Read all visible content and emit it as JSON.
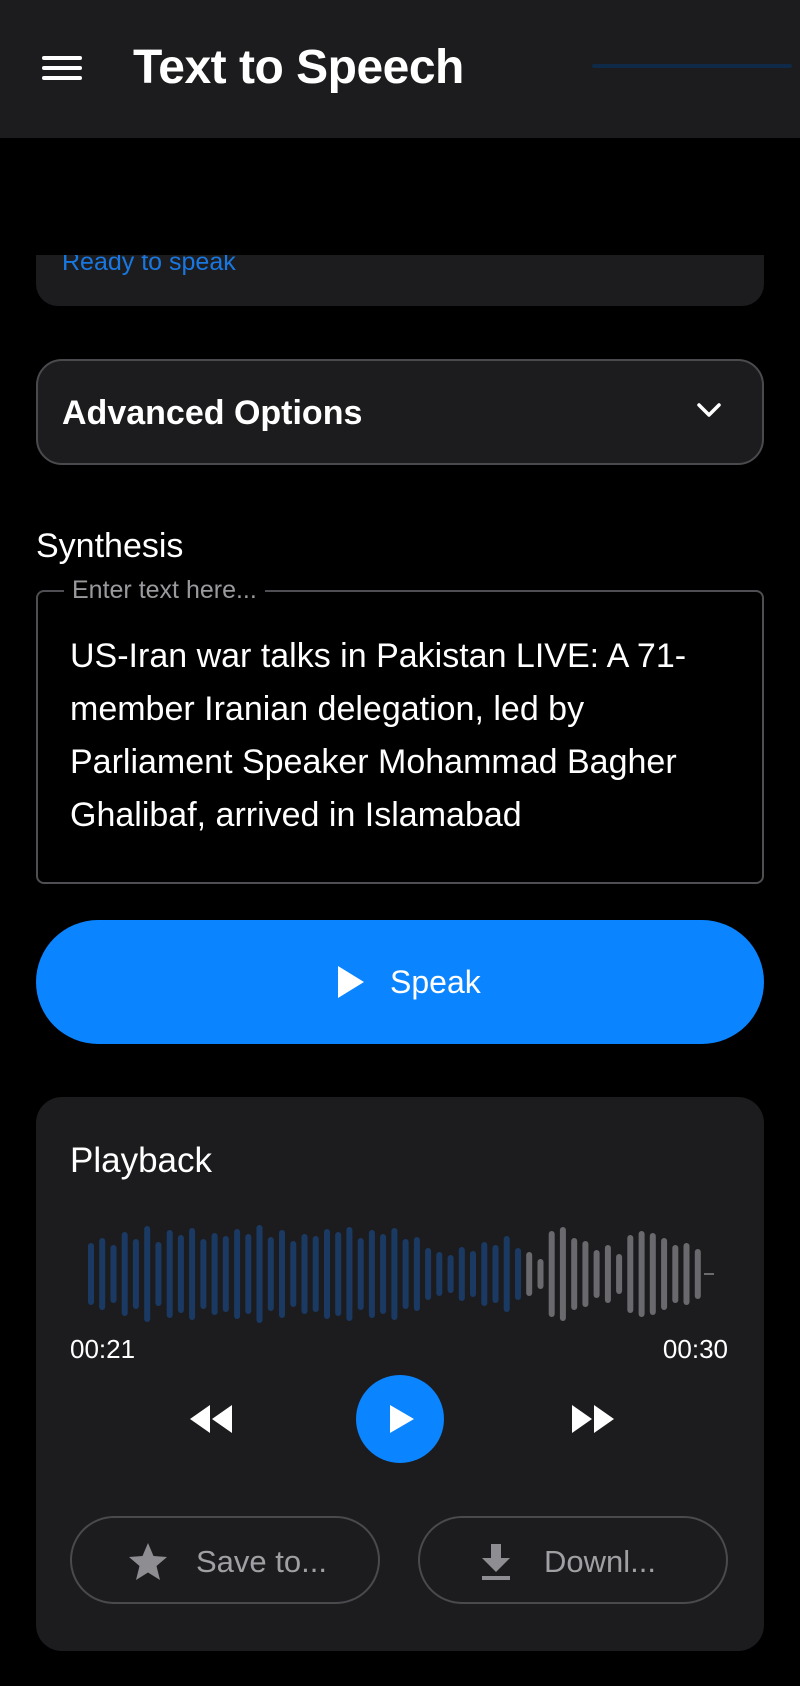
{
  "appbar": {
    "title": "Text to Speech",
    "menu_icon": "hamburger-menu-icon"
  },
  "status": {
    "text": "Ready to speak"
  },
  "advanced_options": {
    "label": "Advanced Options",
    "icon": "chevron-down-icon",
    "expanded": false
  },
  "synthesis": {
    "section_title": "Synthesis",
    "placeholder": "Enter text here...",
    "text": "US-Iran war talks in Pakistan LIVE: A 71-member Iranian delegation, led by Parliament Speaker Mohammad Bagher Ghalibaf, arrived in Islamabad"
  },
  "speak_button": {
    "label": "Speak",
    "icon": "play-icon"
  },
  "playback": {
    "title": "Playback",
    "current_time": "00:21",
    "total_time": "00:30",
    "progress": 0.7,
    "rewind_icon": "rewind-icon",
    "play_icon": "play-icon",
    "forward_icon": "fast-forward-icon",
    "save_label": "Save to...",
    "save_icon": "star-icon",
    "download_label": "Downl...",
    "download_icon": "download-icon"
  },
  "colors": {
    "accent": "#0a84ff",
    "status_text": "#1877e0",
    "card_background": "#1c1c1e",
    "waveform_played": "#1a3a64",
    "waveform_unplayed": "#6a6a6e"
  }
}
